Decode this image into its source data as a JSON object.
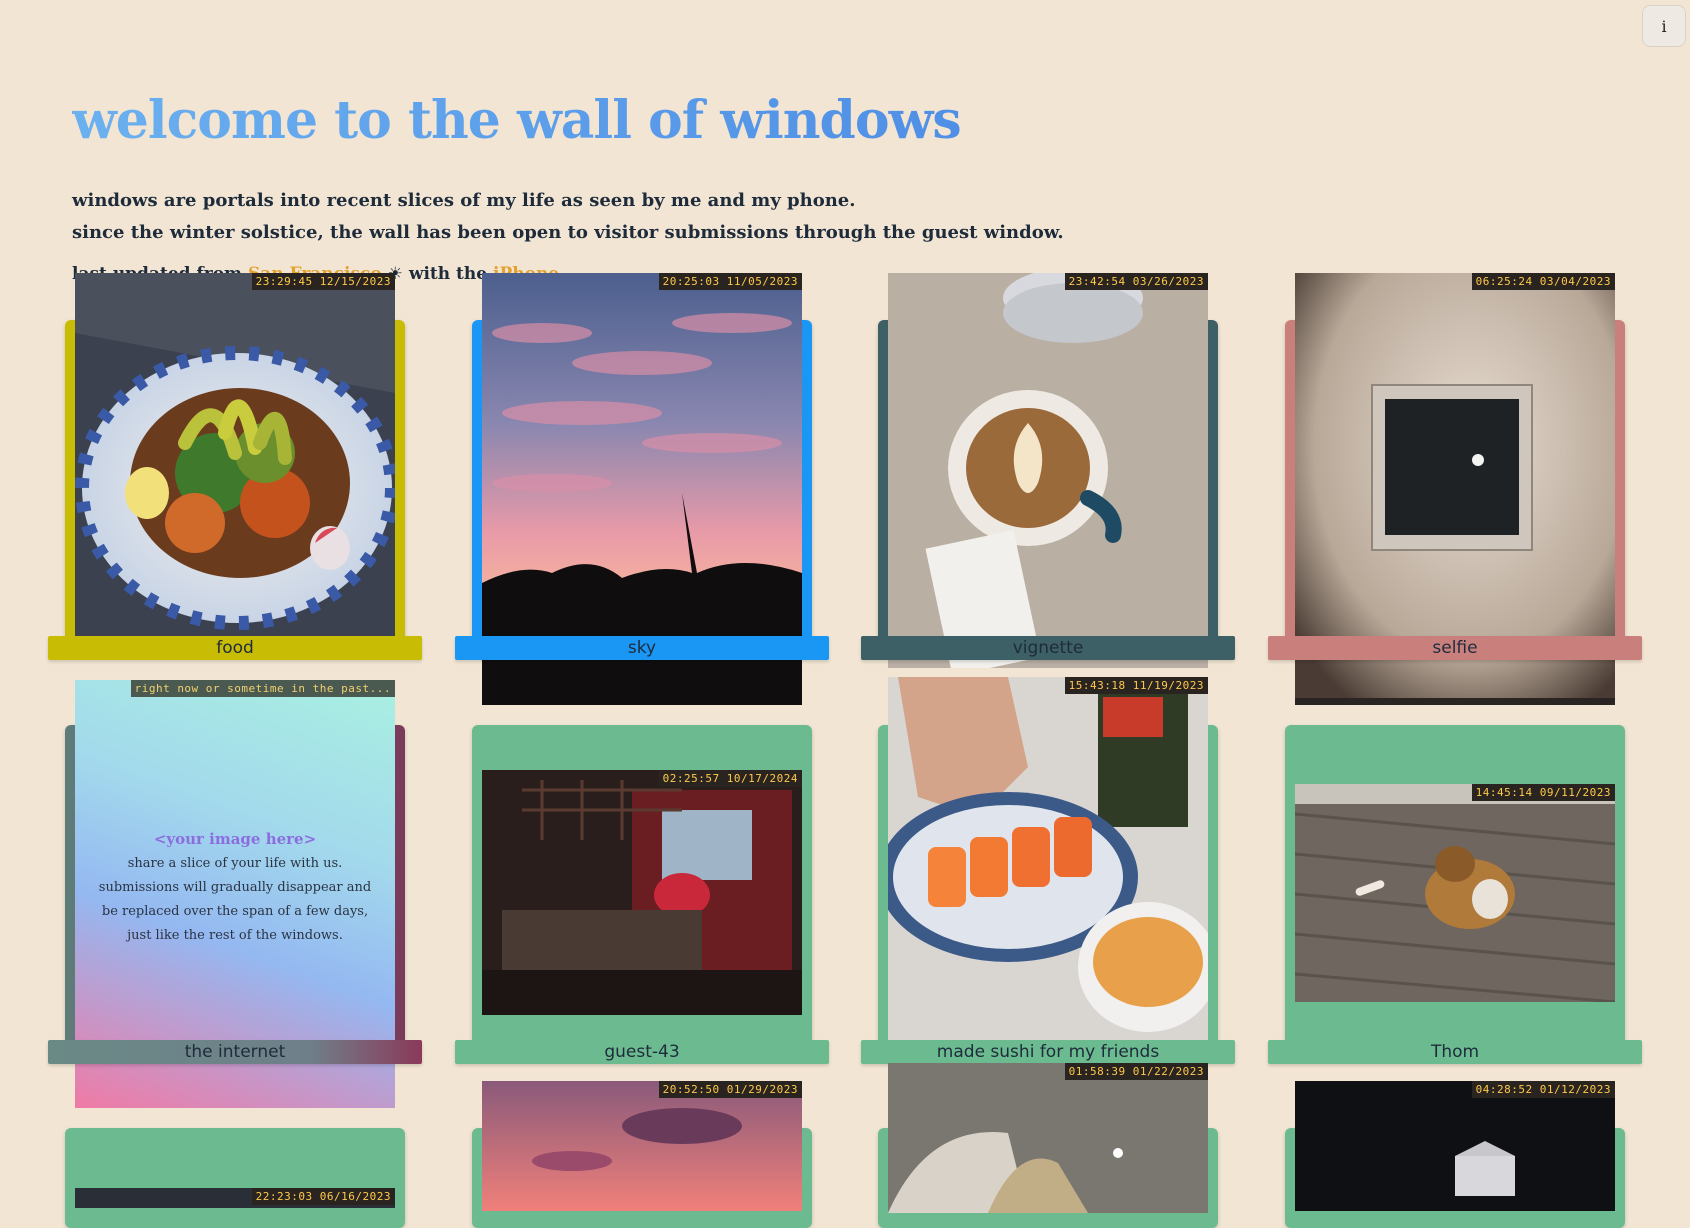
{
  "info_button": "i",
  "header": {
    "title": "welcome to the wall of windows",
    "intro_line1": "windows are portals into recent slices of my life as seen by me and my phone.",
    "intro_line2": "since the winter solstice, the wall has been open to visitor submissions through the guest window.",
    "updated_prefix": "last updated from",
    "updated_place": "San Francisco",
    "updated_mid": "with the",
    "updated_device": "iPhone"
  },
  "windows": [
    {
      "label": "food",
      "timestamp": "23:29:45 12/15/2023",
      "color": "#c8bc05"
    },
    {
      "label": "sky",
      "timestamp": "20:25:03 11/05/2023",
      "color": "#1a96f5"
    },
    {
      "label": "vignette",
      "timestamp": "23:42:54 03/26/2023",
      "color": "#3d5f66"
    },
    {
      "label": "selfie",
      "timestamp": "06:25:24 03/04/2023",
      "color": "#c9807d"
    },
    {
      "label": "the internet",
      "timestamp": "right now or sometime in the past...",
      "color": "#6a8a86"
    },
    {
      "label": "guest-43",
      "timestamp": "02:25:57 10/17/2024",
      "color": "#6cbb90"
    },
    {
      "label": "made sushi for my friends",
      "timestamp": "15:43:18 11/19/2023",
      "color": "#6cbb90"
    },
    {
      "label": "Thom",
      "timestamp": "14:45:14 09/11/2023",
      "color": "#6cbb90"
    },
    {
      "label": "",
      "timestamp": "22:23:03 06/16/2023",
      "color": "#6cbb90"
    },
    {
      "label": "",
      "timestamp": "20:52:50 01/29/2023",
      "color": "#6cbb90"
    },
    {
      "label": "",
      "timestamp": "01:58:39 01/22/2023",
      "color": "#6cbb90"
    },
    {
      "label": "",
      "timestamp": "04:28:52 01/12/2023",
      "color": "#6cbb90"
    }
  ],
  "guest": {
    "title": "<your image here>",
    "text": "share a slice of your life with us. submissions will gradually disappear and be replaced over the span of a few days, just like the rest of the windows."
  }
}
